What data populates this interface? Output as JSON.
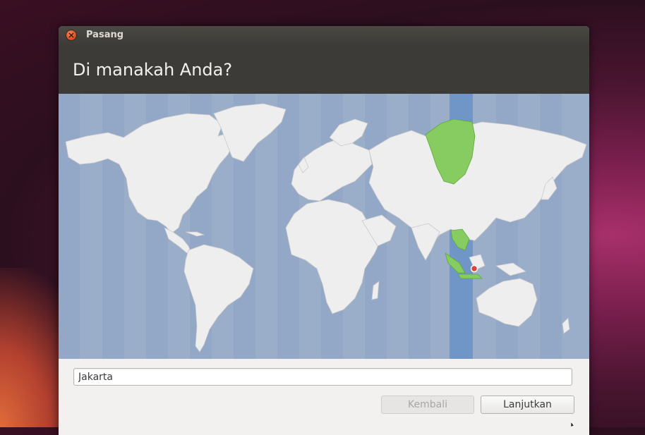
{
  "window": {
    "title": "Pasang",
    "close_icon": "close-icon"
  },
  "header": {
    "title": "Di manakah Anda?"
  },
  "map": {
    "selected_timezone_highlight": "#7096c8",
    "selected_region_color": "#86cc60",
    "land_color": "#efeeee",
    "ocean_color": "#9aaec9",
    "pin_icon": "location-pin-icon"
  },
  "location": {
    "value": "Jakarta"
  },
  "buttons": {
    "back_label": "Kembali",
    "next_label": "Lanjutkan"
  },
  "colors": {
    "titlebar": "#3c3b37",
    "accent_close": "#e1501f"
  }
}
